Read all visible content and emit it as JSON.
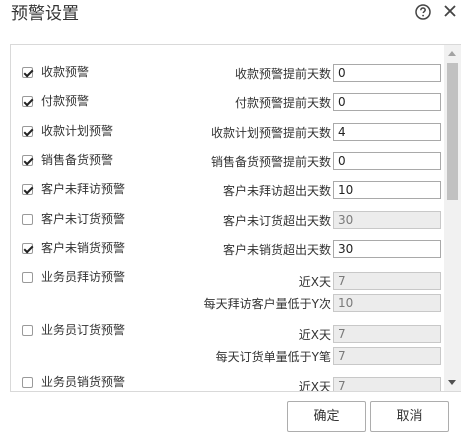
{
  "dialog": {
    "title": "预警设置"
  },
  "rows": [
    {
      "checked": true,
      "label": "收款预警",
      "field_label": "收款预警提前天数",
      "value": "0",
      "disabled": false
    },
    {
      "checked": true,
      "label": "付款预警",
      "field_label": "付款预警提前天数",
      "value": "0",
      "disabled": false
    },
    {
      "checked": true,
      "label": "收款计划预警",
      "field_label": "收款计划预警提前天数",
      "value": "4",
      "disabled": false
    },
    {
      "checked": true,
      "label": "销售备货预警",
      "field_label": "销售备货预警提前天数",
      "value": "0",
      "disabled": false
    },
    {
      "checked": true,
      "label": "客户未拜访预警",
      "field_label": "客户未拜访超出天数",
      "value": "10",
      "disabled": false
    },
    {
      "checked": false,
      "label": "客户未订货预警",
      "field_label": "客户未订货超出天数",
      "value": "30",
      "disabled": true
    },
    {
      "checked": true,
      "label": "客户未销货预警",
      "field_label": "客户未销货超出天数",
      "value": "30",
      "disabled": false
    }
  ],
  "multi_rows": [
    {
      "checked": false,
      "label": "业务员拜访预警",
      "fields": [
        {
          "label": "近X天",
          "value": "7"
        },
        {
          "label": "每天拜访客户量低于Y次",
          "value": "10"
        }
      ]
    },
    {
      "checked": false,
      "label": "业务员订货预警",
      "fields": [
        {
          "label": "近X天",
          "value": "7"
        },
        {
          "label": "每天订货单量低于Y笔",
          "value": "7"
        }
      ]
    },
    {
      "checked": false,
      "label": "业务员销货预警",
      "fields": [
        {
          "label": "近X天",
          "value": "7"
        }
      ]
    }
  ],
  "buttons": {
    "confirm": "确定",
    "cancel": "取消"
  },
  "icons": {
    "help": "help-icon",
    "close": "close-icon"
  }
}
